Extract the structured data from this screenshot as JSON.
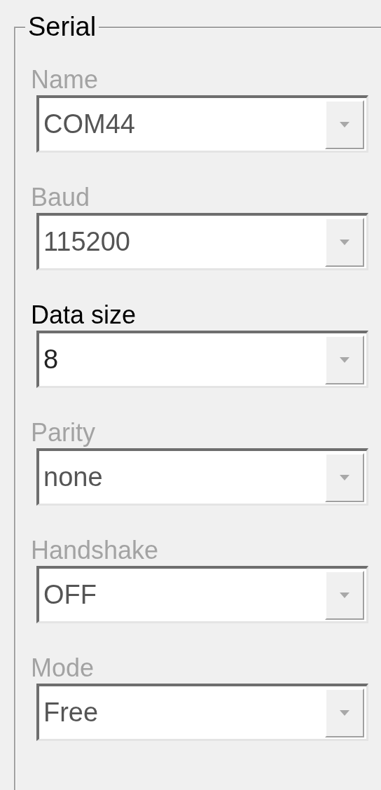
{
  "group": {
    "title": "Serial"
  },
  "fields": [
    {
      "label": "Name",
      "disabled": true,
      "value": "COM44"
    },
    {
      "label": "Baud",
      "disabled": true,
      "value": "115200"
    },
    {
      "label": "Data size",
      "disabled": false,
      "value": "8"
    },
    {
      "label": "Parity",
      "disabled": true,
      "value": "none"
    },
    {
      "label": "Handshake",
      "disabled": true,
      "value": "OFF"
    },
    {
      "label": "Mode",
      "disabled": true,
      "value": "Free"
    }
  ]
}
